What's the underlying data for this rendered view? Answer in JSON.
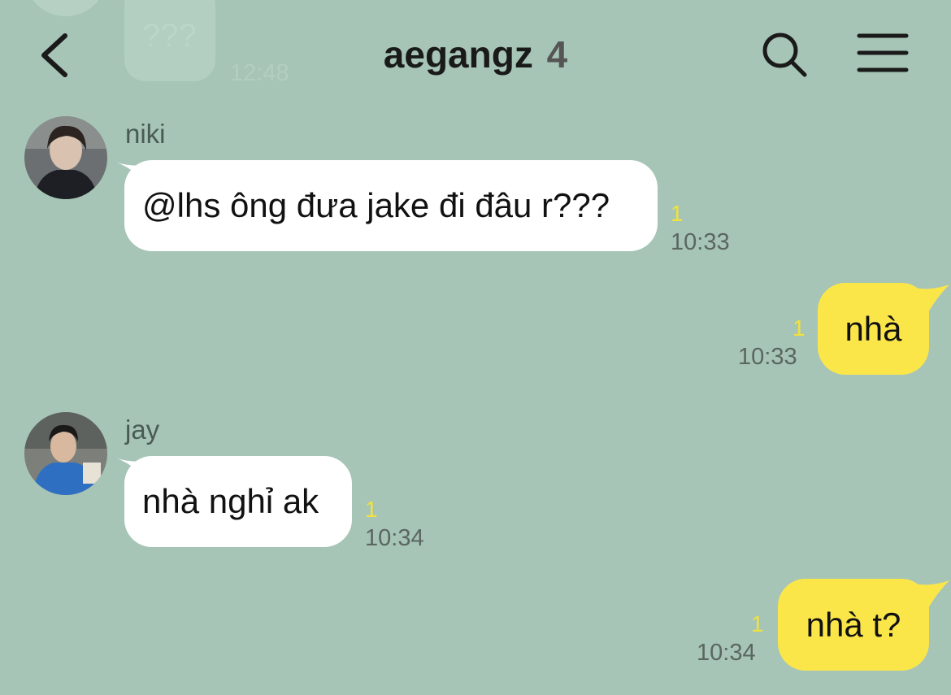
{
  "header": {
    "chat_name": "aegangz",
    "member_count": "4",
    "back_icon": "chevron-left-icon",
    "search_icon": "search-icon",
    "menu_icon": "hamburger-menu-icon"
  },
  "background_message": {
    "text": "???",
    "time": "12:48"
  },
  "colors": {
    "background": "#a6c5b6",
    "incoming_bubble": "#ffffff",
    "outgoing_bubble": "#fbe64a",
    "unread_count": "#f2e23a"
  },
  "messages": [
    {
      "sender": "niki",
      "direction": "incoming",
      "text": "@lhs ông đưa jake đi đâu r???",
      "unread": "1",
      "time": "10:33"
    },
    {
      "direction": "outgoing",
      "text": "nhà",
      "unread": "1",
      "time": "10:33"
    },
    {
      "sender": "jay",
      "direction": "incoming",
      "text": "nhà nghỉ ak",
      "unread": "1",
      "time": "10:34"
    },
    {
      "direction": "outgoing",
      "text": "nhà t?",
      "unread": "1",
      "time": "10:34"
    }
  ]
}
